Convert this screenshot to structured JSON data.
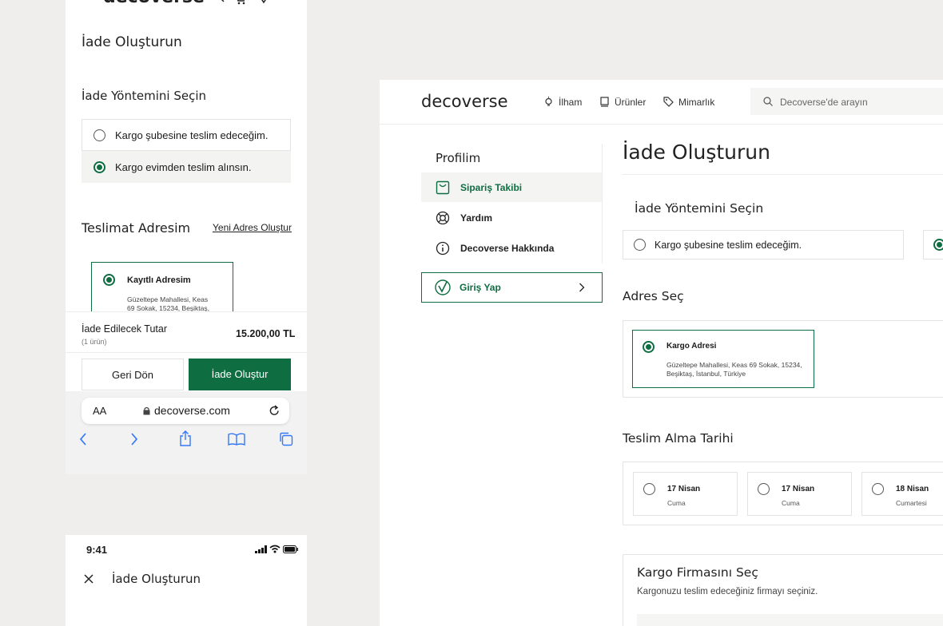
{
  "mobile1": {
    "brand": "decoverse",
    "page_title": "İade Oluşturun",
    "method_title": "İade Yöntemini Seçin",
    "method_options": [
      "Kargo şubesine teslim edeceğim.",
      "Kargo evimden teslim alınsın."
    ],
    "selected_method": 1,
    "address_title": "Teslimat Adresim",
    "new_address_link": "Yeni Adres Oluştur",
    "address_card": {
      "title": "Kayıtlı Adresim",
      "line1": "Güzeltepe Mahallesi, Keas",
      "line2": "69 Sokak, 15234, Beşiktaş,"
    },
    "refund_label": "İade Edilecek Tutar",
    "refund_sub": "(1 ürün)",
    "refund_amount": "15.200,00 TL",
    "back_button": "Geri Dön",
    "create_button": "İade Oluştur",
    "browser": {
      "text_size": "AA",
      "url": "decoverse.com"
    }
  },
  "mobile2": {
    "time": "9:41",
    "page_title": "İade Oluşturun"
  },
  "desktop": {
    "brand": "decoverse",
    "nav": [
      "İlham",
      "Ürünler",
      "Mimarlık"
    ],
    "search_placeholder": "Decoverse'de arayın",
    "sidebar": {
      "title": "Profilim",
      "items": [
        "Sipariş Takibi",
        "Yardım",
        "Decoverse Hakkında"
      ],
      "active_index": 0,
      "login": "Giriş Yap"
    },
    "page_title": "İade Oluşturun",
    "method_title": "İade Yöntemini Seçin",
    "method_option": "Kargo şubesine teslim edeceğim.",
    "address_title": "Adres Seç",
    "address_card": {
      "title": "Kargo Adresi",
      "line1": "Güzeltepe Mahallesi, Keas 69 Sokak, 15234,",
      "line2": "Beşiktaş, İstanbul, Türkiye"
    },
    "date_title": "Teslim Alma Tarihi",
    "dates": [
      {
        "date": "17 Nisan",
        "day": "Cuma"
      },
      {
        "date": "17 Nisan",
        "day": "Cuma"
      },
      {
        "date": "18 Nisan",
        "day": "Cumartesi"
      }
    ],
    "courier_title": "Kargo Firmasını Seç",
    "courier_subtitle": "Kargonuzu teslim edeceğiniz firmayı seçiniz."
  },
  "colors": {
    "accent": "#0f6d42",
    "background": "#efeeec"
  }
}
